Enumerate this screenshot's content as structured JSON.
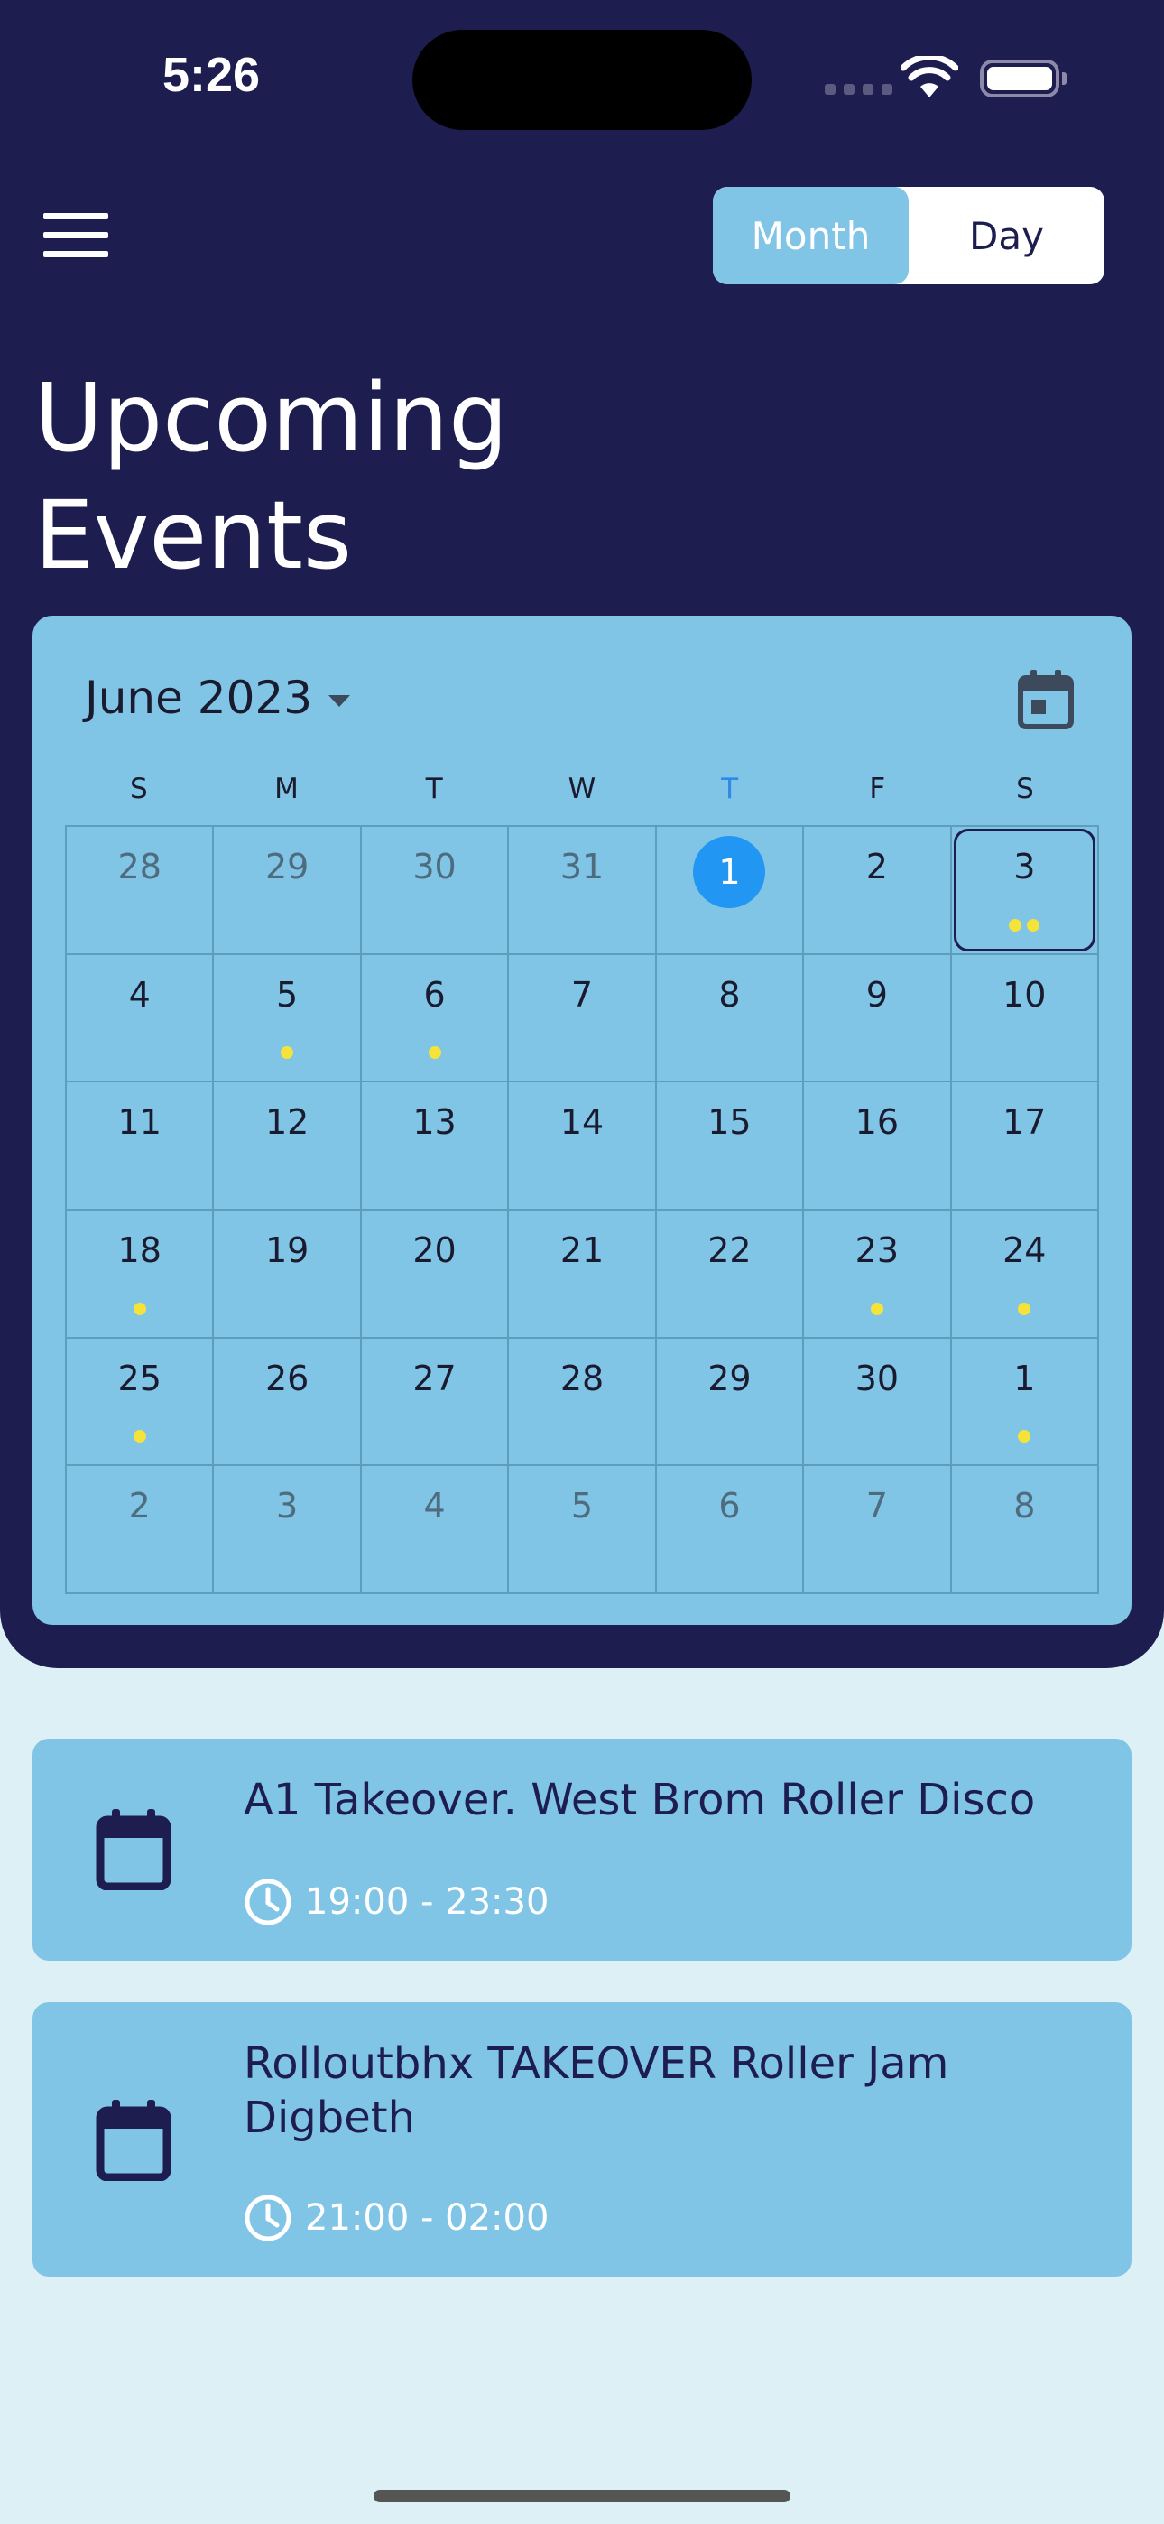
{
  "status_bar": {
    "time": "5:26"
  },
  "toolbar": {
    "toggle_month": "Month",
    "toggle_day": "Day"
  },
  "page": {
    "title_line1": "Upcoming",
    "title_line2": "Events"
  },
  "calendar": {
    "month_label": "June 2023",
    "weekdays": [
      "S",
      "M",
      "T",
      "W",
      "T",
      "F",
      "S"
    ],
    "today_weekday_index": 4,
    "weeks": [
      [
        {
          "d": "28",
          "out": true
        },
        {
          "d": "29",
          "out": true
        },
        {
          "d": "30",
          "out": true
        },
        {
          "d": "31",
          "out": true
        },
        {
          "d": "1",
          "today": true
        },
        {
          "d": "2"
        },
        {
          "d": "3",
          "selected": true,
          "events": 2
        }
      ],
      [
        {
          "d": "4"
        },
        {
          "d": "5",
          "events": 1
        },
        {
          "d": "6",
          "events": 1
        },
        {
          "d": "7"
        },
        {
          "d": "8"
        },
        {
          "d": "9"
        },
        {
          "d": "10"
        }
      ],
      [
        {
          "d": "11"
        },
        {
          "d": "12"
        },
        {
          "d": "13"
        },
        {
          "d": "14"
        },
        {
          "d": "15"
        },
        {
          "d": "16"
        },
        {
          "d": "17"
        }
      ],
      [
        {
          "d": "18",
          "events": 1
        },
        {
          "d": "19"
        },
        {
          "d": "20"
        },
        {
          "d": "21"
        },
        {
          "d": "22"
        },
        {
          "d": "23",
          "events": 1
        },
        {
          "d": "24",
          "events": 1
        }
      ],
      [
        {
          "d": "25",
          "events": 1
        },
        {
          "d": "26"
        },
        {
          "d": "27"
        },
        {
          "d": "28"
        },
        {
          "d": "29"
        },
        {
          "d": "30"
        },
        {
          "d": "1",
          "events": 1
        }
      ],
      [
        {
          "d": "2",
          "out": true
        },
        {
          "d": "3",
          "out": true
        },
        {
          "d": "4",
          "out": true
        },
        {
          "d": "5",
          "out": true
        },
        {
          "d": "6",
          "out": true
        },
        {
          "d": "7",
          "out": true
        },
        {
          "d": "8",
          "out": true
        }
      ]
    ]
  },
  "events": [
    {
      "title": "A1 Takeover. West Brom Roller Disco",
      "time": "19:00 - 23:30"
    },
    {
      "title": "Rolloutbhx TAKEOVER Roller Jam Digbeth",
      "time": "21:00 - 02:00"
    }
  ],
  "colors": {
    "header_bg": "#1e1d4f",
    "card_bg": "#80c4e6",
    "page_bg": "#dcf0f6",
    "today_circle": "#2196f3",
    "event_dot": "#f5e33a"
  },
  "icons": {
    "menu": "menu-icon",
    "calendar": "calendar-icon",
    "clock": "clock-icon",
    "dropdown": "dropdown-arrow-icon"
  }
}
